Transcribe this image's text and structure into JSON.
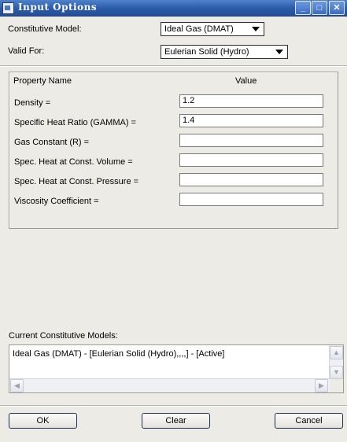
{
  "window": {
    "title": "Input Options"
  },
  "form": {
    "model_label": "Constitutive Model:",
    "model_value": "Ideal Gas (DMAT)",
    "valid_label": "Valid For:",
    "valid_value": "Eulerian Solid (Hydro)"
  },
  "table": {
    "col_name": "Property Name",
    "col_value": "Value",
    "rows": [
      {
        "label": "Density =",
        "value": "1.2"
      },
      {
        "label": "Specific Heat Ratio (GAMMA) =",
        "value": "1.4"
      },
      {
        "label": "Gas Constant (R) =",
        "value": ""
      },
      {
        "label": "Spec. Heat at Const. Volume =",
        "value": ""
      },
      {
        "label": "Spec. Heat at Const. Pressure =",
        "value": ""
      },
      {
        "label": "Viscosity Coefficient =",
        "value": ""
      }
    ]
  },
  "current": {
    "label": "Current Constitutive Models:",
    "items": [
      "Ideal Gas (DMAT) - [Eulerian Solid (Hydro),,,,] - [Active]"
    ]
  },
  "buttons": {
    "ok": "OK",
    "clear": "Clear",
    "cancel": "Cancel"
  }
}
